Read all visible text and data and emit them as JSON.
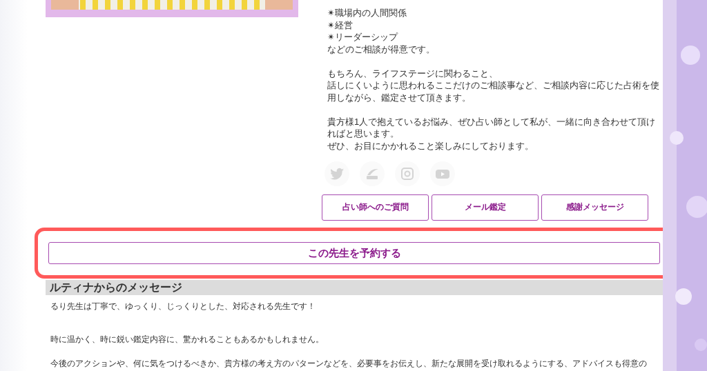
{
  "profile": {
    "picture": {
      "kind": "picture"
    },
    "specialties": [
      "✴職場内の人間関係",
      "✴経営",
      "✴リーダーシップ"
    ],
    "paragraphs": [
      [
        "などのご相談が得意です。"
      ],
      [
        "もちろん、ライフステージに関わること、",
        "話しにくいように思われるここだけのご相談事など、ご相談内容に応じた占術を使用しながら、鑑定させて頂きます。"
      ],
      [
        "貴方様1人で抱えているお悩み、ぜひ占い師として私が、一緒に向き合わせて頂ければと思います。",
        "ぜひ、お目にかかれること楽しみにしております。"
      ]
    ],
    "social": [
      {
        "kind": "twitter"
      },
      {
        "kind": "blog"
      },
      {
        "kind": "instagram"
      },
      {
        "kind": "youtube"
      }
    ],
    "buttons": [
      "占い師へのご質問",
      "メール鑑定",
      "感謝メッセージ"
    ]
  },
  "reserve_button": {
    "label": "この先生を予約する",
    "highlighted": true
  },
  "message": {
    "heading": "ルティナからのメッセージ",
    "paragraphs": [
      "るり先生は丁寧で、ゆっくり、じっくりとした、対応される先生です！",
      "時に温かく、時に鋭い鑑定内容に、驚かれることもあるかもしれません。",
      "今後のアクションや、何に気をつけるべきか、貴方様の考え方のパターンなどを、必要事をお伝えし、新たな展開を受け取れるようにする、アドバイスも得意の"
    ]
  }
}
